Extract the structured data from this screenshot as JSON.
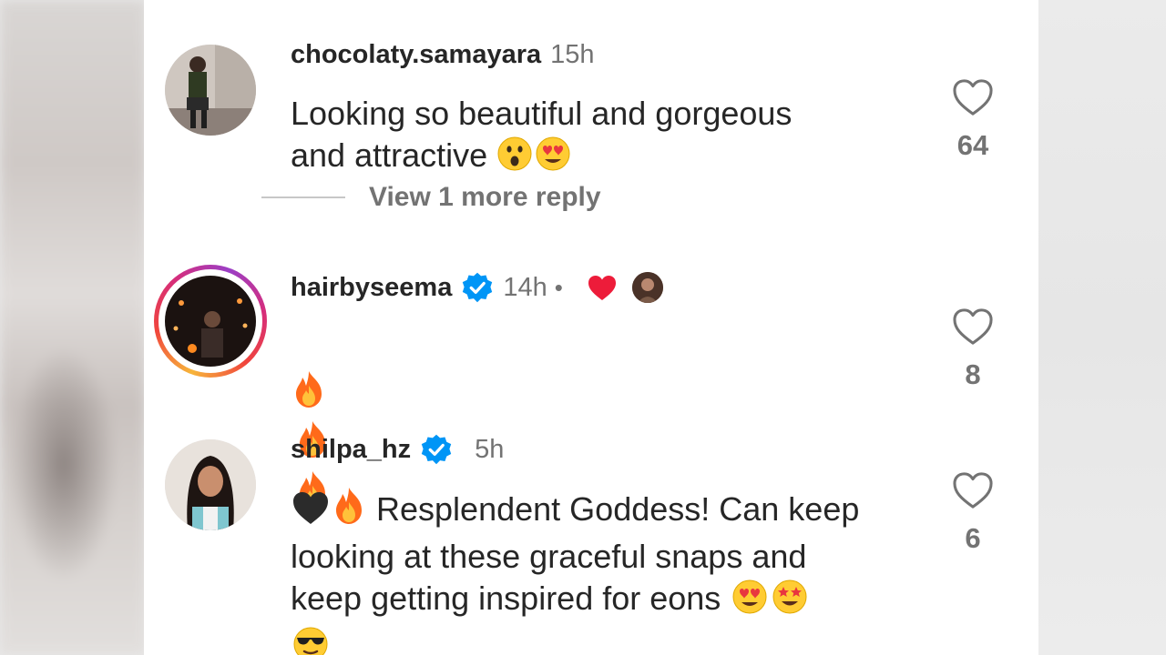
{
  "comments": [
    {
      "username": "chocolaty.samayara",
      "time": "15h",
      "verified": false,
      "text": "Looking so beautiful and gorgeous\nand attractive",
      "text_emojis": [
        "astonished-face",
        "heart-eyes"
      ],
      "likes": "64",
      "view_replies": "View 1 more reply"
    },
    {
      "username": "hairbyseema",
      "time": "14h",
      "separator": "•",
      "verified": true,
      "has_story": true,
      "creator_liked": true,
      "text_emojis": [
        "fire",
        "fire",
        "fire"
      ],
      "likes": "8"
    },
    {
      "username": "shilpa_hz",
      "time": "5h",
      "verified": true,
      "text": "Resplendent Goddess! Can keep\nlooking at these graceful snaps and\nkeep getting inspired for eons",
      "leading_emojis": [
        "black-heart",
        "fire"
      ],
      "text_emojis": [
        "heart-eyes",
        "star-struck",
        "sunglasses"
      ],
      "likes": "6"
    }
  ],
  "colors": {
    "text": "#262626",
    "secondary": "#737373",
    "verified_blue": "#0095f6",
    "like_red": "#ed4956"
  }
}
